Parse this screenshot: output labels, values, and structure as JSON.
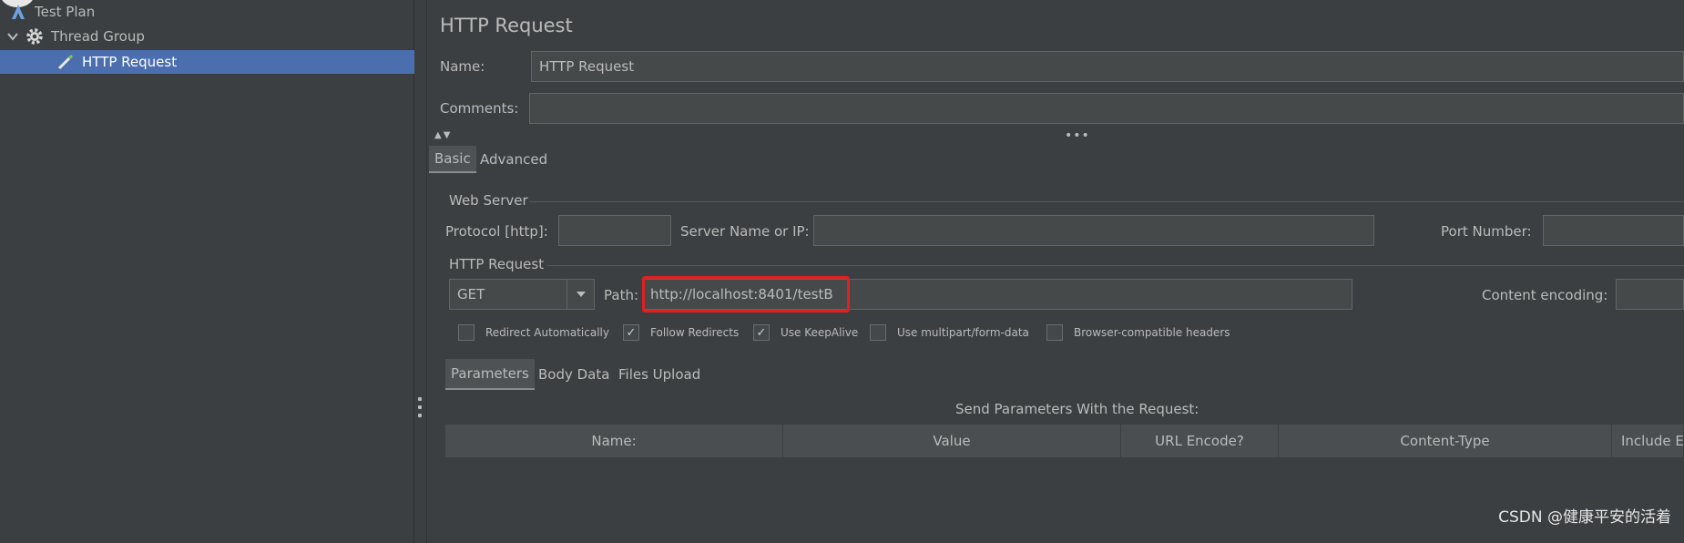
{
  "tree": {
    "items": [
      {
        "label": "Test Plan",
        "icon": "test-plan-icon"
      },
      {
        "label": "Thread Group",
        "icon": "gear-icon"
      },
      {
        "label": "HTTP Request",
        "icon": "pipette-icon"
      }
    ]
  },
  "panel": {
    "title": "HTTP Request",
    "name_label": "Name:",
    "name_value": "HTTP Request",
    "comments_label": "Comments:",
    "comments_value": ""
  },
  "tabs": [
    "Basic",
    "Advanced"
  ],
  "web_server": {
    "group_label": "Web Server",
    "protocol_label": "Protocol [http]:",
    "protocol_value": "",
    "server_label": "Server Name or IP:",
    "server_value": "",
    "port_label": "Port Number:",
    "port_value": ""
  },
  "http_request": {
    "group_label": "HTTP Request",
    "method": "GET",
    "path_label": "Path:",
    "path_value": "http://localhost:8401/testB",
    "encoding_label": "Content encoding:",
    "encoding_value": "",
    "highlight_color": "#e02020"
  },
  "checkboxes": [
    {
      "label": "Redirect Automatically",
      "checked": false
    },
    {
      "label": "Follow Redirects",
      "checked": true
    },
    {
      "label": "Use KeepAlive",
      "checked": true
    },
    {
      "label": "Use multipart/form-data",
      "checked": false
    },
    {
      "label": "Browser-compatible headers",
      "checked": false
    }
  ],
  "sub_tabs": [
    "Parameters",
    "Body Data",
    "Files Upload"
  ],
  "params": {
    "caption": "Send Parameters With the Request:",
    "columns": [
      "Name:",
      "Value",
      "URL Encode?",
      "Content-Type",
      "Include Equals?"
    ]
  },
  "watermark": "CSDN @健康平安的活着"
}
